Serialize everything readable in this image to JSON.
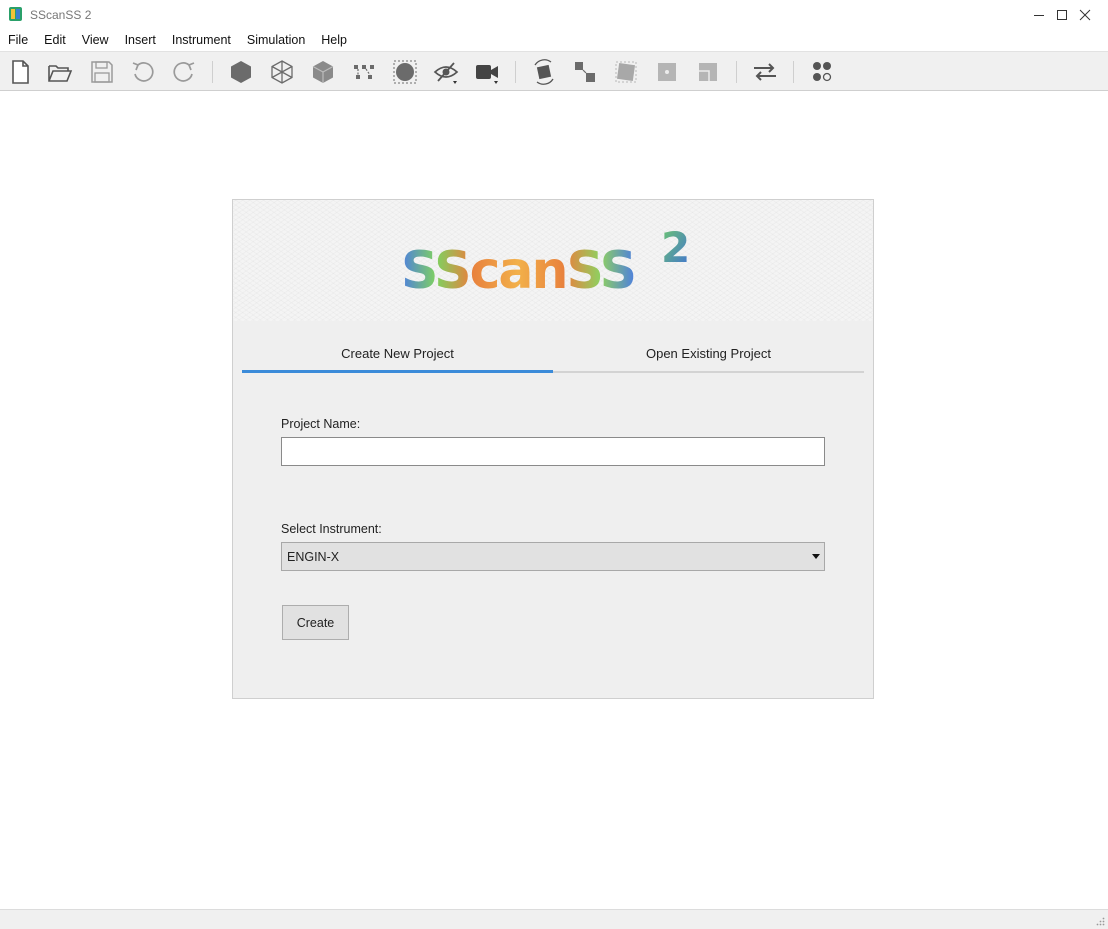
{
  "window": {
    "title": "SScanSS 2"
  },
  "menu": [
    "File",
    "Edit",
    "View",
    "Insert",
    "Instrument",
    "Simulation",
    "Help"
  ],
  "toolbar": {
    "icons": [
      "new-file-icon",
      "open-folder-icon",
      "save-icon",
      "undo-icon",
      "redo-icon",
      "solid-view-icon",
      "wireframe-view-icon",
      "transparent-view-icon",
      "points-view-icon",
      "sample-icon",
      "hide-icon",
      "camera-icon",
      "rotate-icon",
      "translate-icon",
      "transform-icon",
      "move-origin-icon",
      "plane-align-icon",
      "swap-icon",
      "scene-icon"
    ]
  },
  "welcome": {
    "logo_text": "SScanSS",
    "logo_superscript": "2",
    "tabs": [
      {
        "label": "Create New Project",
        "active": true
      },
      {
        "label": "Open Existing Project",
        "active": false
      }
    ],
    "project_name_label": "Project Name:",
    "project_name_value": "",
    "instrument_label": "Select Instrument:",
    "instrument_selected": "ENGIN-X",
    "create_label": "Create"
  },
  "colors": {
    "accent": "#3b8bd9",
    "panel": "#efefef",
    "toolbar": "#f0f0f0",
    "icon": "#6b6b6b"
  }
}
